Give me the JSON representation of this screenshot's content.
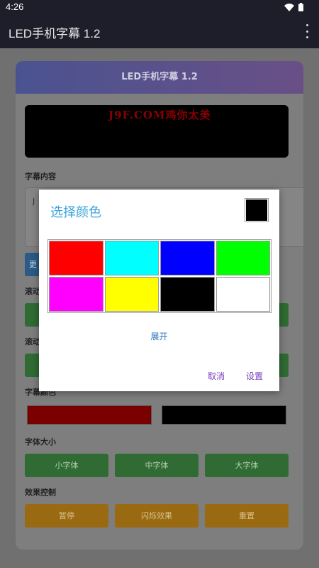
{
  "status_bar": {
    "time": "4:26"
  },
  "app_bar": {
    "title": "LED手机字幕 1.2"
  },
  "card": {
    "header_title": "LED手机字幕 1.2",
    "led_text": "J9F.COM鸡你太美",
    "content_label": "字幕内容",
    "content_value": "J",
    "update_button_partial": "更",
    "scroll_label_1_partial": "滚动",
    "scroll_label_2_partial": "滚动",
    "color_label_partial": "字幕颜色",
    "font_size_label": "字体大小",
    "font_buttons": [
      "小字体",
      "中字体",
      "大字体"
    ],
    "effect_label": "效果控制",
    "effect_buttons": [
      "暂停",
      "闪烁效果",
      "重置"
    ],
    "text_color": "#c00000",
    "bg_color": "#000000"
  },
  "dialog": {
    "title": "选择颜色",
    "selected_color": "#000000",
    "swatches": [
      "#ff0000",
      "#00ffff",
      "#0000ff",
      "#00ff00",
      "#ff00ff",
      "#ffff00",
      "#000000",
      "#ffffff"
    ],
    "expand_label": "展开",
    "cancel_label": "取消",
    "confirm_label": "设置"
  }
}
